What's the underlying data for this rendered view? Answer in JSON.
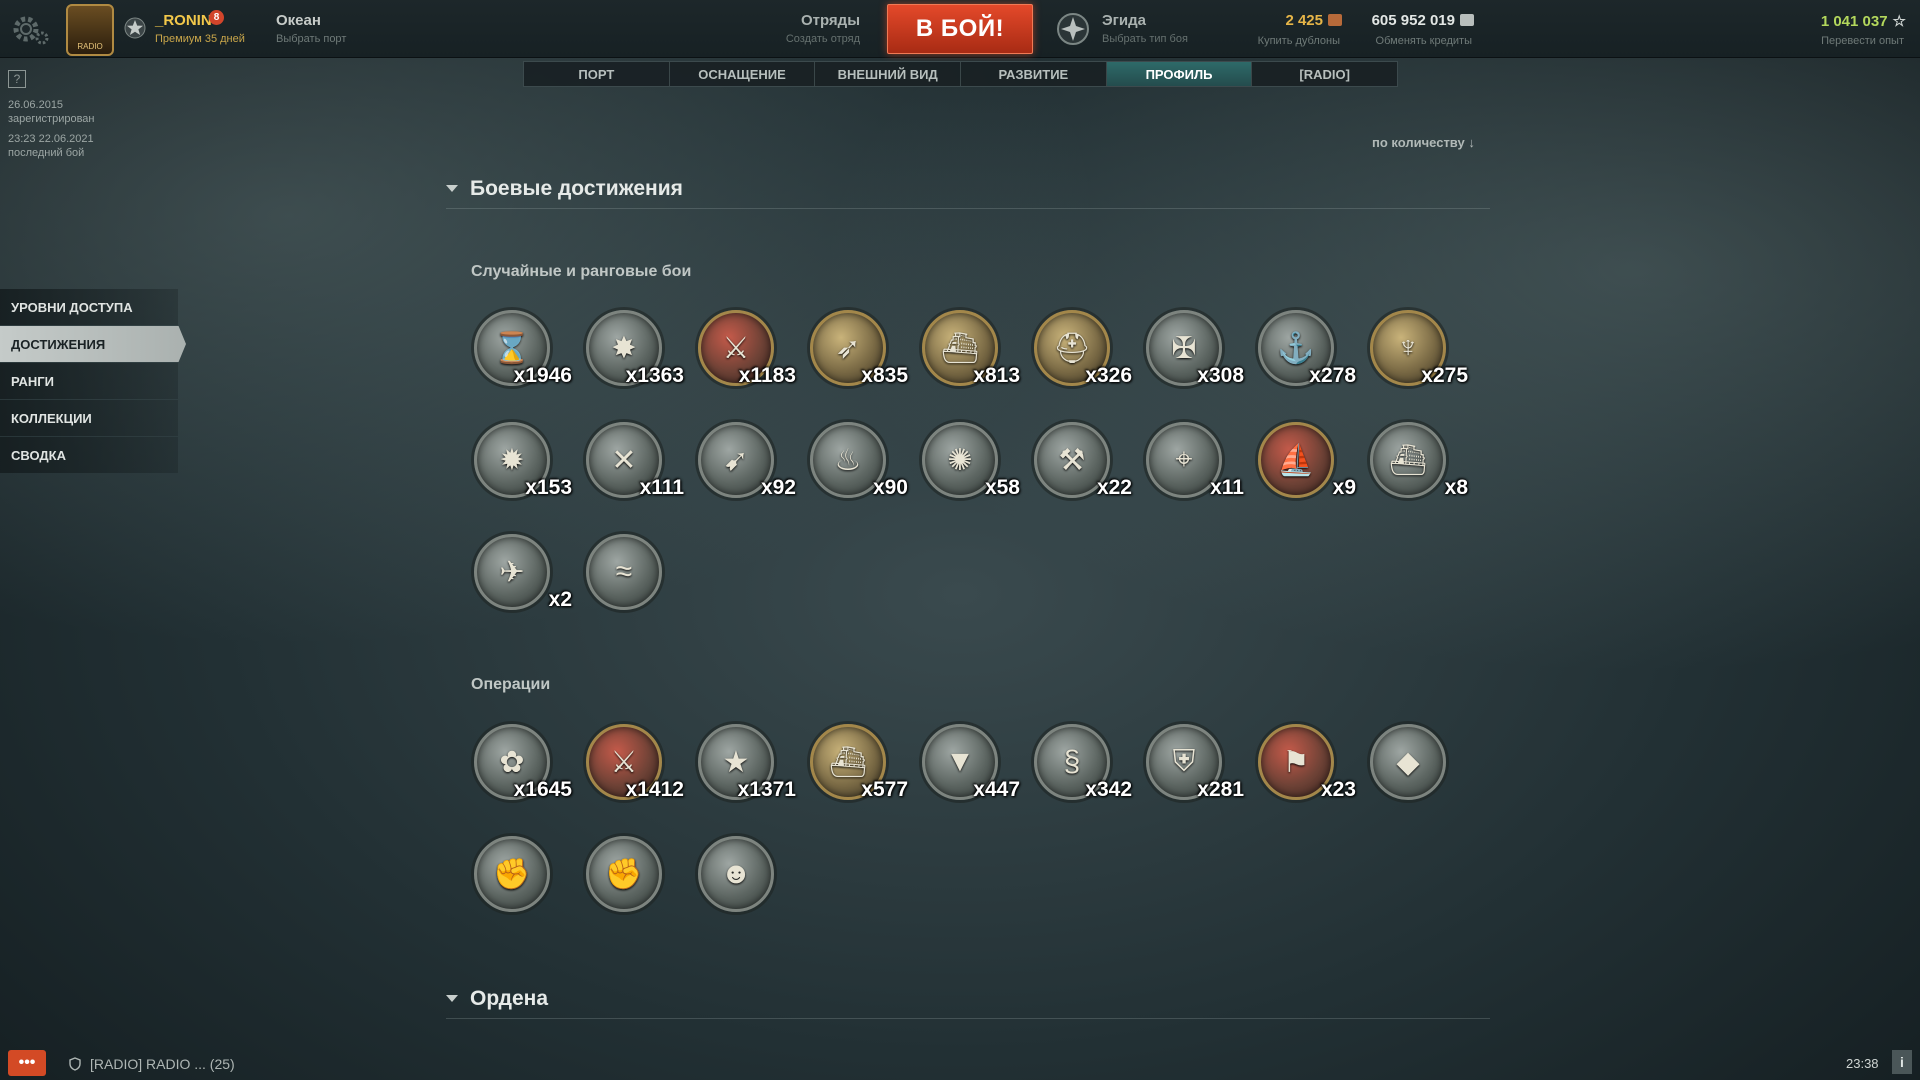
{
  "topbar": {
    "player_name": "_RONIN",
    "player_badge": "8",
    "emblem_text": "RADIO",
    "premium_text": "Премиум 35 дней",
    "port_name": "Океан",
    "port_sub": "Выбрать порт",
    "squad_title": "Отряды",
    "squad_sub": "Создать отряд",
    "battle_label": "В БОЙ!",
    "mode_title": "Эгида",
    "mode_sub": "Выбрать тип боя",
    "doubloons": "2 425",
    "doubloons_sub": "Купить дублоны",
    "credits": "605 952 019",
    "credits_sub": "Обменять кредиты",
    "free_xp": "1 041 037",
    "free_xp_sub": "Перевести опыт",
    "colors": {
      "doubloons": "#e6b548",
      "credits": "#e2e6e4",
      "free_xp": "#b3d75c",
      "battle": "#d53c1e"
    }
  },
  "nav_tabs": [
    {
      "label": "ПОРТ"
    },
    {
      "label": "ОСНАЩЕНИЕ"
    },
    {
      "label": "ВНЕШНИЙ ВИД"
    },
    {
      "label": "РАЗВИТИЕ"
    },
    {
      "label": "ПРОФИЛЬ",
      "active": true
    },
    {
      "label": "[RADIO]"
    }
  ],
  "account_info": {
    "help_label": "?",
    "registered_date": "26.06.2015",
    "registered_label": "зарегистрирован",
    "last_battle_date": "23:23  22.06.2021",
    "last_battle_label": "последний бой"
  },
  "side_menu": [
    {
      "label": "УРОВНИ ДОСТУПА"
    },
    {
      "label": "ДОСТИЖЕНИЯ",
      "active": true
    },
    {
      "label": "РАНГИ"
    },
    {
      "label": "КОЛЛЕКЦИИ"
    },
    {
      "label": "СВОДКА"
    }
  ],
  "sort_label": "по количеству ↓",
  "sections": {
    "battle_achievements": "Боевые достижения",
    "random_ranked": "Случайные и ранговые бои",
    "operations": "Операции",
    "orders": "Ордена"
  },
  "random_medals": [
    {
      "icon": "hourglass-icon",
      "glyph": "⌛",
      "count": "x1946",
      "tone": "silver"
    },
    {
      "icon": "explosion-icon",
      "glyph": "✸",
      "count": "x1363",
      "tone": "silver"
    },
    {
      "icon": "crossed-swords-icon",
      "glyph": "⚔",
      "count": "x1183",
      "tone": "red"
    },
    {
      "icon": "torpedo-icon",
      "glyph": "➶",
      "count": "x835",
      "tone": "gold"
    },
    {
      "icon": "battleship-icon",
      "glyph": "⛴",
      "count": "x813",
      "tone": "gold"
    },
    {
      "icon": "helmet-icon",
      "glyph": "⛑",
      "count": "x326",
      "tone": "gold"
    },
    {
      "icon": "cross-icon",
      "glyph": "✠",
      "count": "x308",
      "tone": "silver"
    },
    {
      "icon": "anchor-icon",
      "glyph": "⚓",
      "count": "x278",
      "tone": "silver"
    },
    {
      "icon": "trident-icon",
      "glyph": "♆",
      "count": "x275",
      "tone": "gold"
    },
    {
      "icon": "turret-icon",
      "glyph": "✹",
      "count": "x153",
      "tone": "silver"
    },
    {
      "icon": "double-strike-icon",
      "glyph": "✕",
      "count": "x111",
      "tone": "silver"
    },
    {
      "icon": "rifle-icon",
      "glyph": "➹",
      "count": "x92",
      "tone": "silver"
    },
    {
      "icon": "fire-icon",
      "glyph": "♨",
      "count": "x90",
      "tone": "silver"
    },
    {
      "icon": "burst-icon",
      "glyph": "✺",
      "count": "x58",
      "tone": "silver"
    },
    {
      "icon": "submarine-icon",
      "glyph": "⚒",
      "count": "x22",
      "tone": "silver"
    },
    {
      "icon": "crosshair-icon",
      "glyph": "⌖",
      "count": "x11",
      "tone": "silver"
    },
    {
      "icon": "ribbon-ship-icon",
      "glyph": "⛵",
      "count": "x9",
      "tone": "red"
    },
    {
      "icon": "ship-bow-icon",
      "glyph": "⛴",
      "count": "x8",
      "tone": "silver"
    },
    {
      "icon": "airplane-icon",
      "glyph": "✈",
      "count": "x2",
      "tone": "silver"
    },
    {
      "icon": "wave-ship-icon",
      "glyph": "≈",
      "count": "",
      "tone": "silver"
    }
  ],
  "operation_medals": [
    {
      "icon": "kraken-icon",
      "glyph": "✿",
      "count": "x1645",
      "tone": "silver"
    },
    {
      "icon": "red-swords-icon",
      "glyph": "⚔",
      "count": "x1412",
      "tone": "red"
    },
    {
      "icon": "starfish-icon",
      "glyph": "★",
      "count": "x1371",
      "tone": "silver"
    },
    {
      "icon": "gold-ship-icon",
      "glyph": "⛴",
      "count": "x577",
      "tone": "gold"
    },
    {
      "icon": "fox-icon",
      "glyph": "▼",
      "count": "x447",
      "tone": "silver"
    },
    {
      "icon": "serpent-icon",
      "glyph": "§",
      "count": "x342",
      "tone": "silver"
    },
    {
      "icon": "shield-icon",
      "glyph": "⛨",
      "count": "x281",
      "tone": "silver"
    },
    {
      "icon": "ribbon-icon",
      "glyph": "⚑",
      "count": "x23",
      "tone": "red"
    },
    {
      "icon": "rock-icon",
      "glyph": "◆",
      "count": "",
      "tone": "silver"
    },
    {
      "icon": "fist-icon",
      "glyph": "✊",
      "count": "",
      "tone": "silver"
    },
    {
      "icon": "raised-fist-icon",
      "glyph": "✊",
      "count": "",
      "tone": "silver"
    },
    {
      "icon": "diver-icon",
      "glyph": "☻",
      "count": "",
      "tone": "silver"
    }
  ],
  "bottombar": {
    "chat_label": "•••",
    "channel": "[RADIO] RADIO ... (25)",
    "clock": "23:38",
    "info_label": "i"
  }
}
